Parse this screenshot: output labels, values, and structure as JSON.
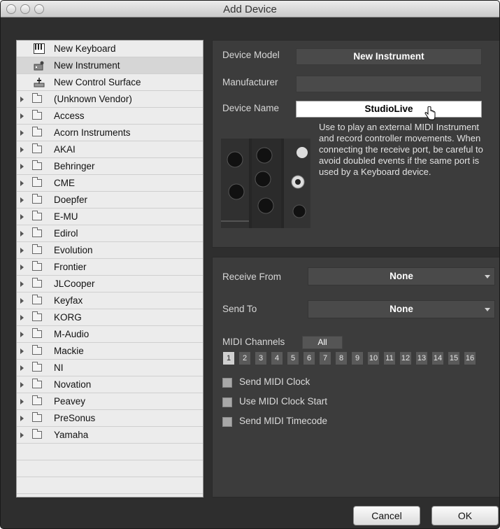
{
  "window": {
    "title": "Add Device"
  },
  "device_list": {
    "items": [
      {
        "label": "New Keyboard",
        "icon": "keyboard-icon",
        "expandable": false
      },
      {
        "label": "New Instrument",
        "icon": "instrument-icon",
        "expandable": false,
        "selected": true
      },
      {
        "label": "New Control Surface",
        "icon": "control-surface-icon",
        "expandable": false
      },
      {
        "label": "(Unknown Vendor)",
        "icon": "folder-icon",
        "expandable": true
      },
      {
        "label": "Access",
        "icon": "folder-icon",
        "expandable": true
      },
      {
        "label": "Acorn Instruments",
        "icon": "folder-icon",
        "expandable": true
      },
      {
        "label": "AKAI",
        "icon": "folder-icon",
        "expandable": true
      },
      {
        "label": "Behringer",
        "icon": "folder-icon",
        "expandable": true
      },
      {
        "label": "CME",
        "icon": "folder-icon",
        "expandable": true
      },
      {
        "label": "Doepfer",
        "icon": "folder-icon",
        "expandable": true
      },
      {
        "label": "E-MU",
        "icon": "folder-icon",
        "expandable": true
      },
      {
        "label": "Edirol",
        "icon": "folder-icon",
        "expandable": true
      },
      {
        "label": "Evolution",
        "icon": "folder-icon",
        "expandable": true
      },
      {
        "label": "Frontier",
        "icon": "folder-icon",
        "expandable": true
      },
      {
        "label": "JLCooper",
        "icon": "folder-icon",
        "expandable": true
      },
      {
        "label": "Keyfax",
        "icon": "folder-icon",
        "expandable": true
      },
      {
        "label": "KORG",
        "icon": "folder-icon",
        "expandable": true
      },
      {
        "label": "M-Audio",
        "icon": "folder-icon",
        "expandable": true
      },
      {
        "label": "Mackie",
        "icon": "folder-icon",
        "expandable": true
      },
      {
        "label": "NI",
        "icon": "folder-icon",
        "expandable": true
      },
      {
        "label": "Novation",
        "icon": "folder-icon",
        "expandable": true
      },
      {
        "label": "Peavey",
        "icon": "folder-icon",
        "expandable": true
      },
      {
        "label": "PreSonus",
        "icon": "folder-icon",
        "expandable": true
      },
      {
        "label": "Yamaha",
        "icon": "folder-icon",
        "expandable": true
      }
    ]
  },
  "device_info": {
    "model_label": "Device Model",
    "model_value": "New Instrument",
    "manufacturer_label": "Manufacturer",
    "manufacturer_value": "",
    "name_label": "Device Name",
    "name_value": "StudioLive",
    "description": "Use to play an external MIDI Instrument and record controller movements. When connecting the receive port, be careful to avoid doubled events if the same port is used by a Keyboard device."
  },
  "midi": {
    "receive_label": "Receive From",
    "receive_value": "None",
    "send_label": "Send To",
    "send_value": "None",
    "channels_label": "MIDI Channels",
    "all_label": "All",
    "channels": [
      "1",
      "2",
      "3",
      "4",
      "5",
      "6",
      "7",
      "8",
      "9",
      "10",
      "11",
      "12",
      "13",
      "14",
      "15",
      "16"
    ],
    "selected_channel": "1",
    "options": [
      {
        "label": "Send MIDI Clock",
        "checked": false
      },
      {
        "label": "Use MIDI Clock Start",
        "checked": false
      },
      {
        "label": "Send MIDI Timecode",
        "checked": false
      }
    ]
  },
  "buttons": {
    "cancel": "Cancel",
    "ok": "OK"
  }
}
